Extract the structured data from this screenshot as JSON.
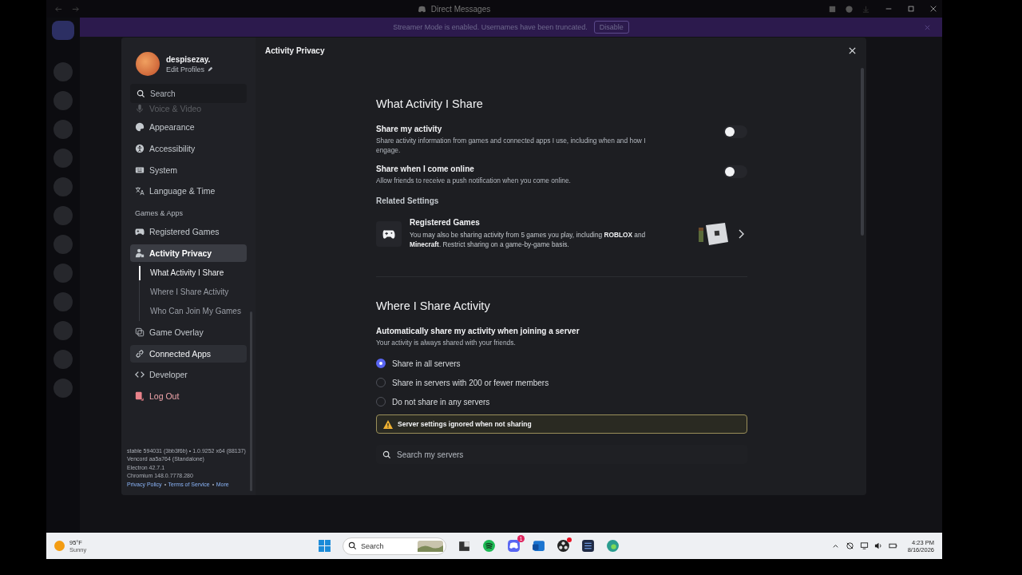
{
  "titlebar": {
    "title": "Direct Messages"
  },
  "banner": {
    "text": "Streamer Mode is enabled. Usernames have been truncated.",
    "button": "Disable"
  },
  "profile": {
    "name": "despisezay.",
    "edit": "Edit Profiles"
  },
  "sidebar": {
    "search": {
      "placeholder": "Search"
    },
    "items": [
      {
        "kind": "item",
        "label": "Voice & Video",
        "selected": false,
        "hovered": false
      },
      {
        "kind": "item",
        "label": "Appearance",
        "selected": false,
        "hovered": false
      },
      {
        "kind": "item",
        "label": "Accessibility",
        "selected": false,
        "hovered": false
      },
      {
        "kind": "item",
        "label": "System",
        "selected": false,
        "hovered": false
      },
      {
        "kind": "item",
        "label": "Language & Time",
        "selected": false,
        "hovered": false
      },
      {
        "kind": "heading",
        "label": "Games & Apps"
      },
      {
        "kind": "item",
        "label": "Registered Games",
        "selected": false,
        "hovered": false
      },
      {
        "kind": "item",
        "label": "Activity Privacy",
        "selected": true,
        "hovered": false,
        "children": [
          {
            "label": "What Activity I Share",
            "selected": true
          },
          {
            "label": "Where I Share Activity",
            "selected": false
          },
          {
            "label": "Who Can Join My Games",
            "selected": false
          }
        ]
      },
      {
        "kind": "item",
        "label": "Game Overlay",
        "selected": false,
        "hovered": false
      },
      {
        "kind": "item",
        "label": "Connected Apps",
        "selected": false,
        "hovered": true
      },
      {
        "kind": "item",
        "label": "Developer",
        "selected": false,
        "hovered": false
      },
      {
        "kind": "danger",
        "label": "Log Out",
        "selected": false,
        "hovered": false
      }
    ],
    "version_lines": [
      "stable 594031 (3bb3f6b) • 1.0.9252 x64 (88137)",
      "Vencord aa5a764 (Standalone)",
      "Electron 42.7.1",
      "Chromium 148.0.7778.280"
    ],
    "links": [
      "Privacy Policy",
      "Terms of Service",
      "More"
    ]
  },
  "page": {
    "title": "Activity Privacy",
    "section_1": {
      "title": "What Activity I Share",
      "toggles": [
        {
          "label": "Share my activity",
          "description": "Share activity information from games and connected apps I use, including when and how I engage.",
          "on": false
        },
        {
          "label": "Share when I come online",
          "description": "Allow friends to receive a push notification when you come online.",
          "on": false
        }
      ],
      "related_heading": "Related Settings",
      "related_card": {
        "title": "Registered Games",
        "description": "You may also be sharing activity from 5 games you play, including **ROBLOX** and **Minecraft**. Restrict sharing on a game-by-game basis."
      }
    },
    "section_2": {
      "title": "Where I Share Activity",
      "label": "Automatically share my activity when joining a server",
      "description": "Your activity is always shared with your friends.",
      "radios": [
        {
          "label": "Share in all servers",
          "selected": true
        },
        {
          "label": "Share in servers with 200 or fewer members",
          "selected": false
        },
        {
          "label": "Do not share in any servers",
          "selected": false
        }
      ],
      "warning": "Server settings ignored when not sharing",
      "search": {
        "placeholder": "Search my servers"
      }
    }
  },
  "taskbar": {
    "weather": {
      "temp": "95°F",
      "condition": "Sunny"
    },
    "search": {
      "placeholder": "Search"
    },
    "discord_badge": "1",
    "time": "4:23 PM",
    "date": "8/16/2026"
  }
}
